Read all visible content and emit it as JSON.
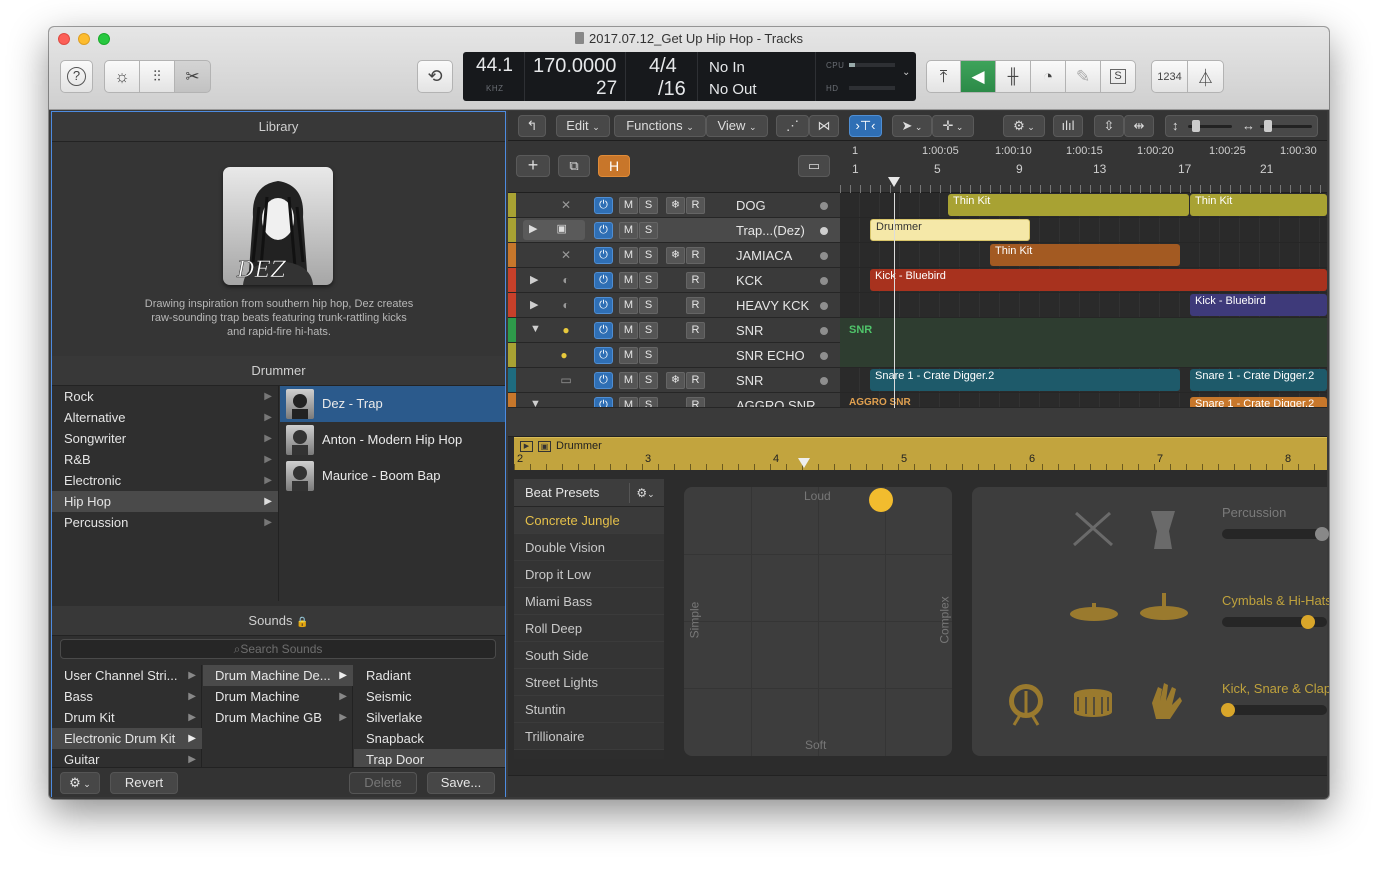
{
  "window": {
    "title": "2017.07.12_Get Up Hip Hop - Tracks"
  },
  "lcd": {
    "sample_rate": "44.1",
    "sample_rate_unit": "KHZ",
    "tempo": "170.0000",
    "tempo_sub": "27",
    "sig_top": "4/4",
    "sig_bottom": "/16",
    "in": "No In",
    "out": "No Out",
    "cpu_label": "CPU",
    "hd_label": "HD"
  },
  "lcd_extra": {
    "count_label": "1234"
  },
  "library": {
    "header": "Library",
    "artist_description": "Drawing inspiration from southern hip hop, Dez creates raw-sounding trap beats featuring trunk-rattling kicks and rapid-fire hi-hats.",
    "avatar_caption": "DEZ",
    "drummer_header": "Drummer",
    "genres": [
      "Rock",
      "Alternative",
      "Songwriter",
      "R&B",
      "Electronic",
      "Hip Hop",
      "Percussion"
    ],
    "selected_genre": "Hip Hop",
    "drummers": [
      "Dez - Trap",
      "Anton - Modern Hip Hop",
      "Maurice - Boom Bap"
    ],
    "sounds_header": "Sounds",
    "search_placeholder": "Search Sounds",
    "sound_col1": [
      "User Channel Stri...",
      "Bass",
      "Drum Kit",
      "Electronic Drum Kit",
      "Guitar"
    ],
    "sound_col2": [
      "Drum Machine De...",
      "Drum Machine",
      "Drum Machine GB"
    ],
    "sound_col3": [
      "Radiant",
      "Seismic",
      "Silverlake",
      "Snapback",
      "Trap Door"
    ],
    "revert": "Revert",
    "delete": "Delete",
    "save": "Save..."
  },
  "track_toolbar": {
    "edit": "Edit",
    "functions": "Functions",
    "view": "View"
  },
  "track_list_buttons": {
    "h_label": "H"
  },
  "ruler": {
    "times": [
      "1",
      "1:00:05",
      "1:00:10",
      "1:00:15",
      "1:00:20",
      "1:00:25",
      "1:00:30"
    ],
    "bars": [
      "1",
      "5",
      "9",
      "13",
      "17",
      "21"
    ]
  },
  "tracks": [
    {
      "name": "DOG",
      "m": "M",
      "s": "S",
      "r": "R",
      "freeze": true
    },
    {
      "name": "Trap...(Dez)",
      "m": "M",
      "s": "S"
    },
    {
      "name": "JAMIACA",
      "m": "M",
      "s": "S",
      "r": "R",
      "freeze": true
    },
    {
      "name": "KCK",
      "m": "M",
      "s": "S",
      "r": "R"
    },
    {
      "name": "HEAVY KCK",
      "m": "M",
      "s": "S",
      "r": "R"
    },
    {
      "name": "SNR",
      "m": "M",
      "s": "S",
      "r": "R"
    },
    {
      "name": "SNR ECHO",
      "m": "M",
      "s": "S"
    },
    {
      "name": "SNR",
      "m": "M",
      "s": "S",
      "r": "R",
      "freeze": true
    },
    {
      "name": "AGGRO SNR",
      "m": "M",
      "s": "S",
      "r": "R"
    }
  ],
  "regions": {
    "thin_kit": "Thin Kit",
    "drummer": "Drummer",
    "kick_bluebird": "Kick - Bluebird",
    "snr_label": "SNR",
    "snare_crate": "Snare 1 - Crate Digger.2",
    "aggro_snr": "AGGRO SNR",
    "snare_crate_cut": "Snare 1 - Crate Digger.2"
  },
  "editor": {
    "region_name": "Drummer",
    "bars": [
      "2",
      "3",
      "4",
      "5",
      "6",
      "7",
      "8"
    ],
    "beat_presets_label": "Beat Presets",
    "presets": [
      "Concrete Jungle",
      "Double Vision",
      "Drop it Low",
      "Miami Bass",
      "Roll Deep",
      "South Side",
      "Street Lights",
      "Stuntin",
      "Trillionaire"
    ],
    "selected_preset": "Concrete Jungle",
    "xy_loud": "Loud",
    "xy_soft": "Soft",
    "xy_simple": "Simple",
    "xy_complex": "Complex",
    "percussion_label": "Percussion",
    "cymbals_label": "Cymbals & Hi-Hats",
    "kick_label": "Kick, Snare & Claps"
  },
  "colors": {
    "accent_blue": "#2f6fb5",
    "drummer_gold": "#c2a43e",
    "preset_highlight": "#e5c04a"
  }
}
